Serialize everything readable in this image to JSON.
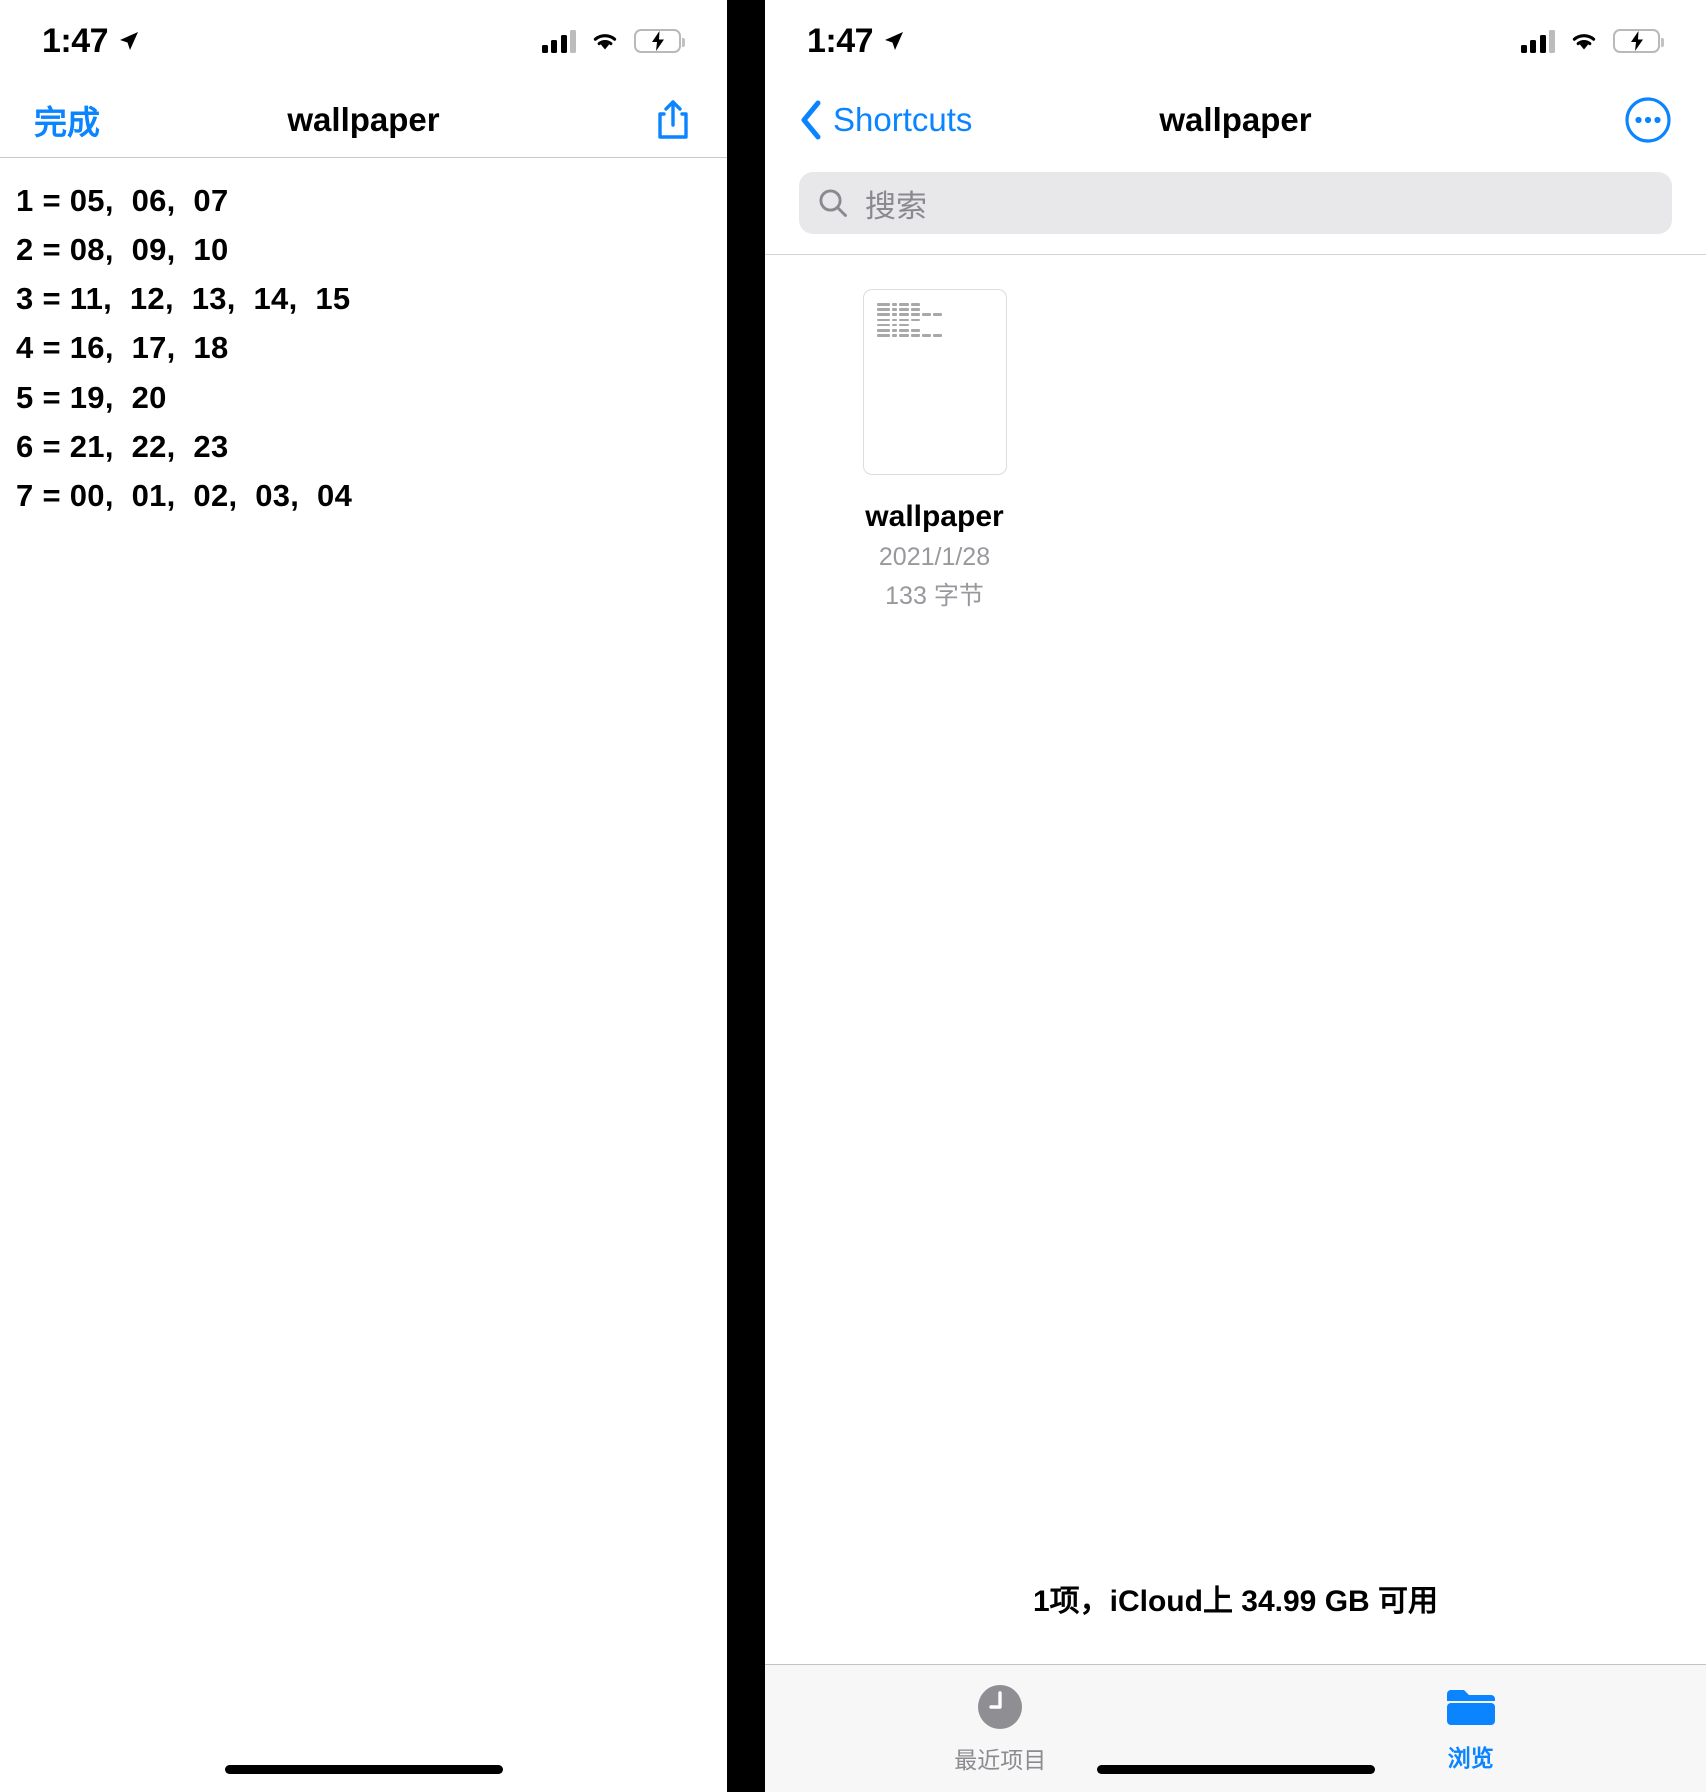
{
  "left_screen": {
    "status_bar": {
      "time": "1:47",
      "location_icon": "location-arrow-icon",
      "signal_icon": "cellular-signal-icon",
      "wifi_icon": "wifi-icon",
      "battery_icon": "battery-charging-icon",
      "battery_color": "#31d158"
    },
    "nav": {
      "done_label": "完成",
      "title": "wallpaper",
      "share_icon": "share-icon",
      "accent_color": "#0a84ff"
    },
    "document": {
      "lines": [
        "1 = 05,  06,  07",
        "2 = 08,  09,  10",
        "3 = 11,  12,  13,  14,  15",
        "4 = 16,  17,  18",
        "5 = 19,  20",
        "6 = 21,  22,  23",
        "7 = 00,  01,  02,  03,  04"
      ]
    }
  },
  "right_screen": {
    "status_bar": {
      "time": "1:47",
      "location_icon": "location-arrow-icon",
      "signal_icon": "cellular-signal-icon",
      "wifi_icon": "wifi-icon",
      "battery_icon": "battery-charging-icon",
      "battery_color": "#31d158"
    },
    "nav": {
      "back_label": "Shortcuts",
      "back_icon": "chevron-left-icon",
      "title": "wallpaper",
      "more_icon": "ellipsis-circle-icon",
      "accent_color": "#0a84ff"
    },
    "search": {
      "placeholder": "搜索",
      "icon": "search-icon"
    },
    "files": [
      {
        "name": "wallpaper",
        "date": "2021/1/28",
        "size": "133 字节",
        "thumbnail_icon": "text-document-thumbnail"
      }
    ],
    "footer_status": "1项，iCloud上 34.99 GB 可用",
    "tab_bar": [
      {
        "label": "最近项目",
        "icon": "clock-icon",
        "active": false
      },
      {
        "label": "浏览",
        "icon": "folder-icon",
        "active": true
      }
    ]
  }
}
